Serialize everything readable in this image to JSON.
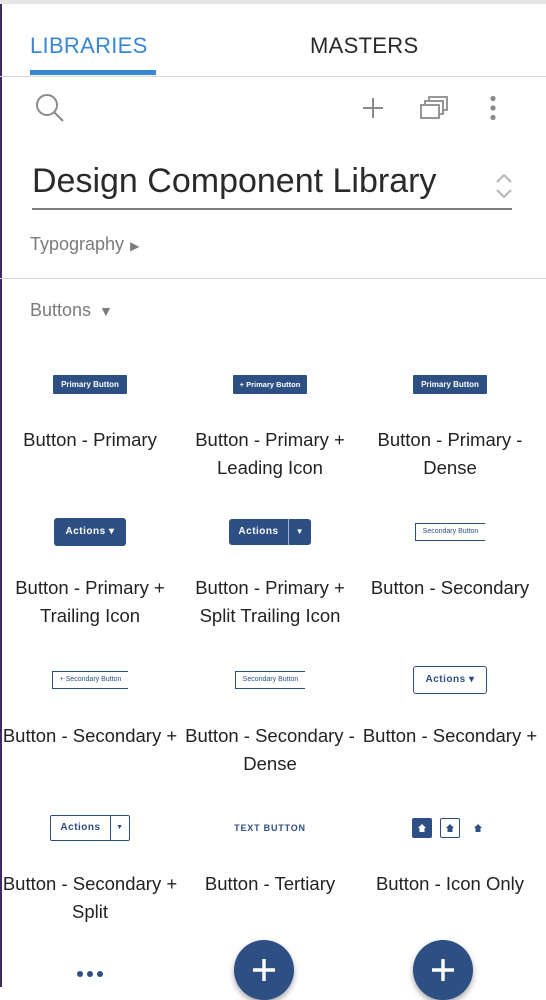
{
  "tabs": [
    {
      "label": "LIBRARIES",
      "active": true
    },
    {
      "label": "MASTERS",
      "active": false
    }
  ],
  "toolbar": {
    "icons": [
      "search-icon",
      "plus-icon",
      "pages-icon",
      "more-vertical-icon"
    ]
  },
  "library": {
    "selected": "Design Component Library"
  },
  "sections": {
    "typography": {
      "label": "Typography",
      "expanded": false
    },
    "buttons": {
      "label": "Buttons",
      "expanded": true
    }
  },
  "components": [
    {
      "label": "Button - Primary",
      "preview": "Primary Button"
    },
    {
      "label": "Button - Primary + Leading Icon",
      "preview": "+ Primary Button"
    },
    {
      "label": "Button - Primary - Dense",
      "preview": "Primary Button"
    },
    {
      "label": "Button - Primary + Trailing Icon",
      "preview": "Actions ▾"
    },
    {
      "label": "Button - Primary + Split Trailing Icon",
      "preview": "Actions"
    },
    {
      "label": "Button - Secondary",
      "preview": "Secondary Button"
    },
    {
      "label": "Button - Secondary +",
      "preview": "+ Secondary Button"
    },
    {
      "label": "Button - Secondary - Dense",
      "preview": "Secondary Button"
    },
    {
      "label": "Button - Secondary +",
      "preview": "Actions ▾"
    },
    {
      "label": "Button - Secondary + Split",
      "preview": "Actions"
    },
    {
      "label": "Button - Tertiary",
      "preview": "TEXT BUTTON"
    },
    {
      "label": "Button - Icon Only",
      "preview": "home-icon"
    }
  ],
  "colors": {
    "accent": "#3a86d6",
    "brand": "#2d4f83"
  }
}
